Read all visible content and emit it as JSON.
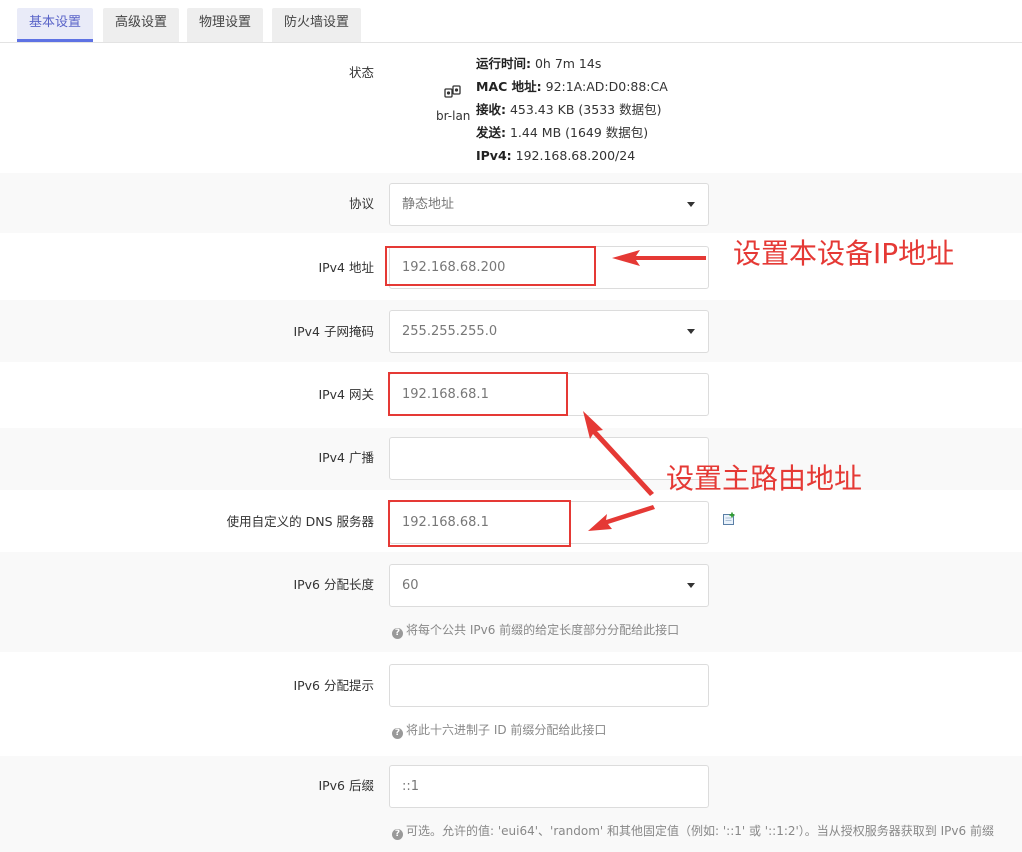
{
  "tabs": [
    "基本设置",
    "高级设置",
    "物理设置",
    "防火墙设置"
  ],
  "status": {
    "label": "状态",
    "iface_name": "br-lan",
    "lines": [
      {
        "key": "运行时间:",
        "value": " 0h 7m 14s"
      },
      {
        "key": "MAC 地址:",
        "value": " 92:1A:AD:D0:88:CA"
      },
      {
        "key": "接收:",
        "value": " 453.43 KB (3533 数据包)"
      },
      {
        "key": "发送:",
        "value": " 1.44 MB (1649 数据包)"
      },
      {
        "key": "IPv4:",
        "value": " 192.168.68.200/24"
      }
    ]
  },
  "fields": {
    "protocol": {
      "label": "协议",
      "value": "静态地址"
    },
    "ipv4_addr": {
      "label": "IPv4 地址",
      "value": "192.168.68.200"
    },
    "ipv4_mask": {
      "label": "IPv4 子网掩码",
      "value": "255.255.255.0"
    },
    "ipv4_gw": {
      "label": "IPv4 网关",
      "value": "192.168.68.1"
    },
    "ipv4_bcast": {
      "label": "IPv4 广播",
      "value": ""
    },
    "dns": {
      "label": "使用自定义的 DNS 服务器",
      "value": "192.168.68.1"
    },
    "ip6assign": {
      "label": "IPv6 分配长度",
      "value": "60",
      "hint": "将每个公共 IPv6 前缀的给定长度部分分配给此接口"
    },
    "ip6hint": {
      "label": "IPv6 分配提示",
      "value": "",
      "hint": "将此十六进制子 ID 前缀分配给此接口"
    },
    "ip6ifaceid": {
      "label": "IPv6 后缀",
      "value": "::1",
      "hint": "可选。允许的值: 'eui64'、'random' 和其他固定值（例如: '::1' 或 '::1:2'）。当从授权服务器获取到 IPv6 前缀"
    }
  },
  "annotations": {
    "set_ip": "设置本设备IP地址",
    "set_router": "设置主路由地址",
    "color": "#e53935"
  }
}
